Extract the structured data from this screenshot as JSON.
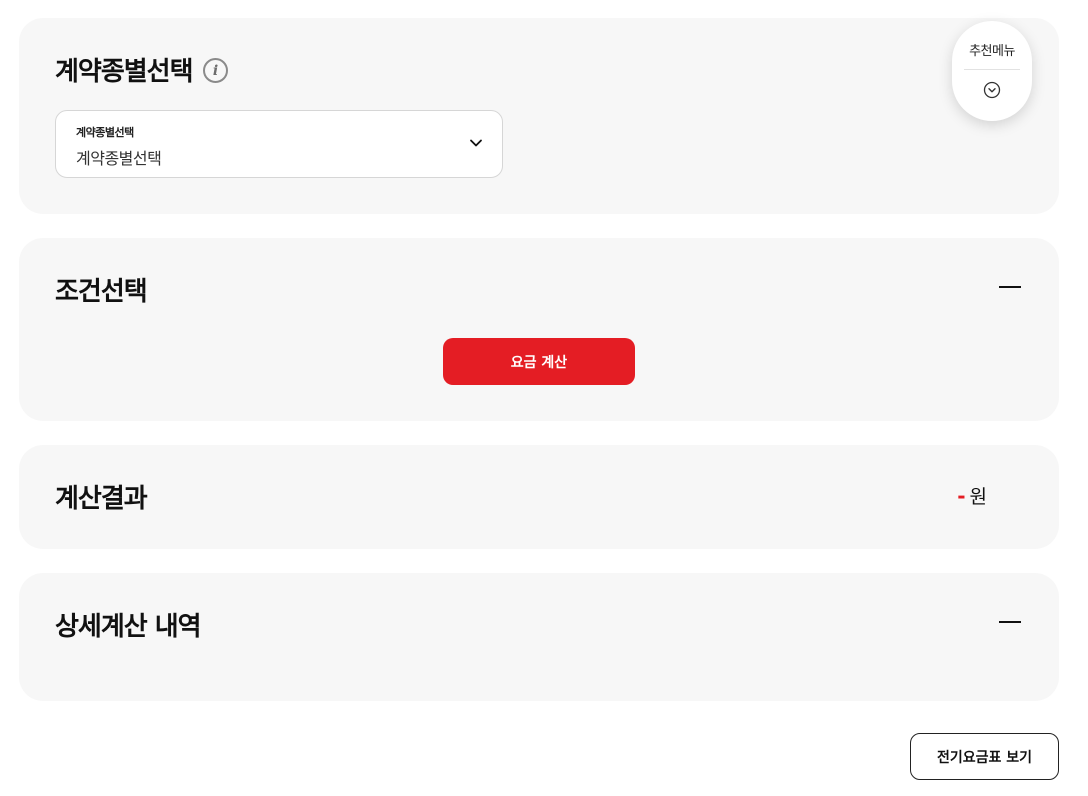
{
  "contract": {
    "title": "계약종별선택",
    "info_icon": "info-icon",
    "select": {
      "label": "계약종별선택",
      "value": "계약종별선택",
      "icon": "chevron-down-icon"
    }
  },
  "condition": {
    "title": "조건선택",
    "collapse_icon": "minus-icon",
    "calc_button_label": "요금 계산"
  },
  "result": {
    "title": "계산결과",
    "value": "-",
    "unit": "원"
  },
  "detail": {
    "title": "상세계산 내역",
    "collapse_icon": "minus-icon"
  },
  "floating_menu": {
    "label": "추천메뉴",
    "icon": "chevron-down-circle-icon"
  },
  "tariff_button_label": "전기요금표 보기",
  "colors": {
    "accent": "#e41d24",
    "card_bg": "#f7f7f7",
    "text": "#111111"
  }
}
